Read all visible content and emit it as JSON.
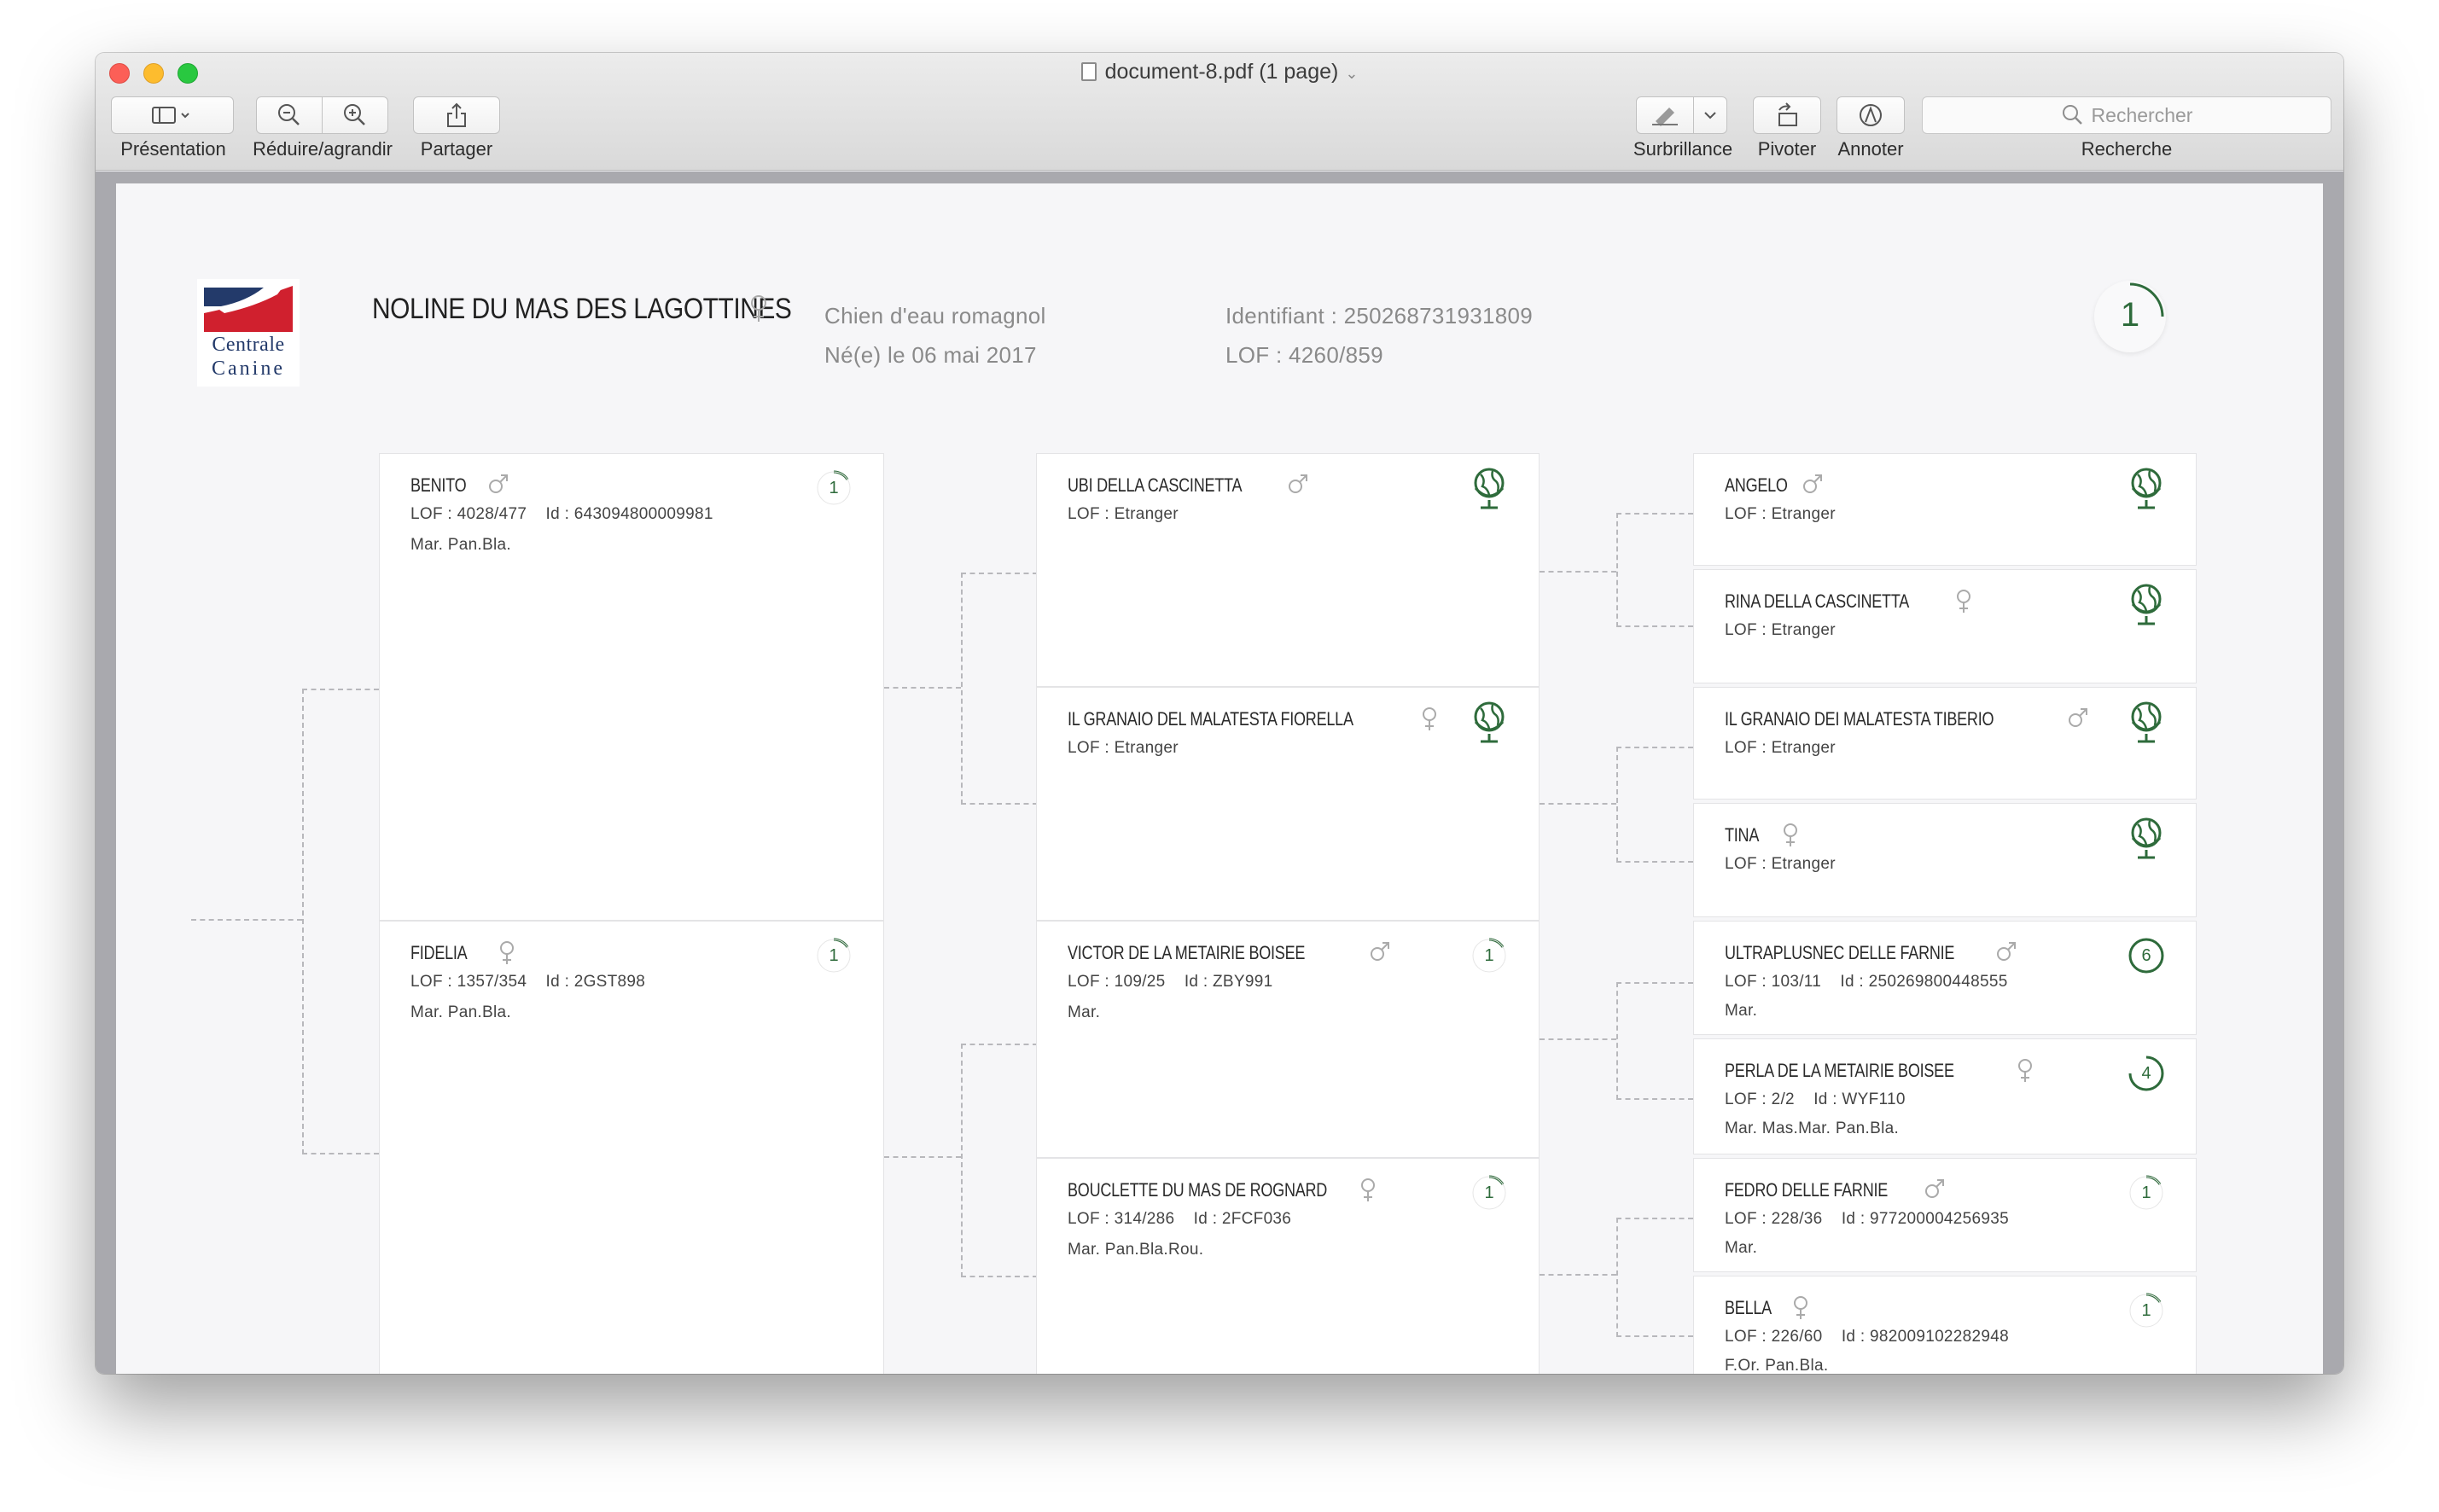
{
  "window": {
    "title": "document-8.pdf (1 page)"
  },
  "toolbar": {
    "presentation_label": "Présentation",
    "zoom_label": "Réduire/agrandir",
    "share_label": "Partager",
    "highlight_label": "Surbrillance",
    "rotate_label": "Pivoter",
    "annotate_label": "Annoter",
    "search_label": "Recherche",
    "search_placeholder": "Rechercher"
  },
  "header": {
    "logo_line1": "Centrale",
    "logo_line2": "Canine",
    "dog_name": "NOLINE DU MAS DES LAGOTTINES",
    "dog_sex": "female",
    "breed": "Chien d'eau romagnol",
    "birth": "Né(e) le 06 mai 2017",
    "identifiant": "Identifiant : 250268731931809",
    "lof": "LOF : 4260/859",
    "badge": "1"
  },
  "colors": {
    "green": "#2e6b3b",
    "logo_blue": "#233a6a",
    "logo_red": "#d0202e"
  },
  "pedigree": {
    "gen1": [
      {
        "name": "BENITO",
        "sex": "male",
        "line1": "LOF : 4028/477    Id : 643094800009981",
        "line2": "Mar. Pan.Bla.",
        "badge": "1",
        "icon": "count"
      },
      {
        "name": "FIDELIA",
        "sex": "female",
        "line1": "LOF : 1357/354    Id : 2GST898",
        "line2": "Mar. Pan.Bla.",
        "badge": "1",
        "icon": "count"
      }
    ],
    "gen2": [
      {
        "name": "UBI DELLA CASCINETTA",
        "sex": "male",
        "line1": "LOF : Etranger",
        "line2": "",
        "badge": "",
        "icon": "globe"
      },
      {
        "name": "IL GRANAIO DEL MALATESTA FIORELLA",
        "sex": "female",
        "line1": "LOF : Etranger",
        "line2": "",
        "badge": "",
        "icon": "globe"
      },
      {
        "name": "VICTOR DE LA METAIRIE BOISEE",
        "sex": "male",
        "line1": "LOF : 109/25    Id : ZBY991",
        "line2": "Mar.",
        "badge": "1",
        "icon": "count"
      },
      {
        "name": "BOUCLETTE DU MAS DE ROGNARD",
        "sex": "female",
        "line1": "LOF : 314/286    Id : 2FCF036",
        "line2": "Mar. Pan.Bla.Rou.",
        "badge": "1",
        "icon": "count"
      }
    ],
    "gen3": [
      {
        "name": "ANGELO",
        "sex": "male",
        "line1": "LOF : Etranger",
        "line2": "",
        "badge": "",
        "icon": "globe"
      },
      {
        "name": "RINA DELLA CASCINETTA",
        "sex": "female",
        "line1": "LOF : Etranger",
        "line2": "",
        "badge": "",
        "icon": "globe"
      },
      {
        "name": "IL GRANAIO DEI MALATESTA TIBERIO",
        "sex": "male",
        "line1": "LOF : Etranger",
        "line2": "",
        "badge": "",
        "icon": "globe"
      },
      {
        "name": "TINA",
        "sex": "female",
        "line1": "LOF : Etranger",
        "line2": "",
        "badge": "",
        "icon": "globe"
      },
      {
        "name": "ULTRAPLUSNEC DELLE FARNIE",
        "sex": "male",
        "line1": "LOF : 103/11    Id : 250269800448555",
        "line2": "Mar.",
        "badge": "6",
        "icon": "count-full"
      },
      {
        "name": "PERLA DE LA METAIRIE BOISEE",
        "sex": "female",
        "line1": "LOF : 2/2    Id : WYF110",
        "line2": "Mar. Mas.Mar. Pan.Bla.",
        "badge": "4",
        "icon": "count-most"
      },
      {
        "name": "FEDRO DELLE FARNIE",
        "sex": "male",
        "line1": "LOF : 228/36    Id : 977200004256935",
        "line2": "Mar.",
        "badge": "1",
        "icon": "count"
      },
      {
        "name": "BELLA",
        "sex": "female",
        "line1": "LOF : 226/60    Id : 982009102282948",
        "line2": "F.Or. Pan.Bla.",
        "badge": "1",
        "icon": "count"
      }
    ]
  }
}
